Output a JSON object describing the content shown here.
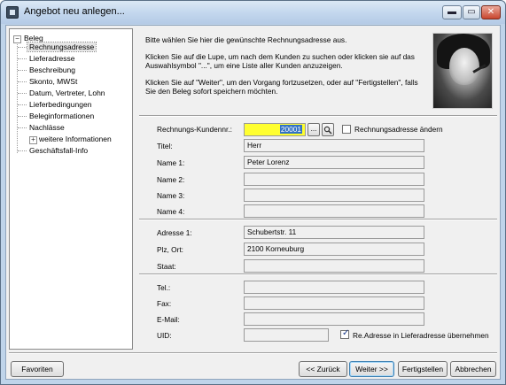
{
  "window": {
    "title": "Angebot neu anlegen..."
  },
  "titlebar_buttons": {
    "minimize": "▬",
    "maximize": "▭",
    "close": "✕"
  },
  "tree": {
    "root": {
      "label": "Beleg",
      "toggle": "−"
    },
    "items": [
      {
        "label": "Rechnungsadresse",
        "selected": true
      },
      {
        "label": "Lieferadresse"
      },
      {
        "label": "Beschreibung"
      },
      {
        "label": "Skonto, MWSt"
      },
      {
        "label": "Datum, Vertreter, Lohn"
      },
      {
        "label": "Lieferbedingungen"
      },
      {
        "label": "Beleginformationen"
      },
      {
        "label": "Nachlässe"
      },
      {
        "label": "weitere Informationen",
        "toggle": "+"
      },
      {
        "label": "Geschäftsfall-Info"
      }
    ]
  },
  "info": {
    "p1": "Bitte wählen Sie hier die gewünschte Rechnungsadresse aus.",
    "p2": "Klicken Sie auf die Lupe, um nach dem Kunden zu suchen oder klicken sie auf das Auswahlsymbol \"...\", um eine Liste aller Kunden anzuzeigen.",
    "p3": "Klicken Sie auf \"Weiter\", um den Vorgang fortzusetzen, oder auf \"Fertigstellen\", falls Sie den Beleg sofort speichern möchten."
  },
  "form": {
    "kundennr_label": "Rechnungs-Kundennr.:",
    "kundennr_value": "20001",
    "browse_button": "...",
    "search_icon": "magnifier-icon",
    "change_address_label": "Rechnungsadresse ändern",
    "change_address_checked": false,
    "titel_label": "Titel:",
    "titel_value": "Herr",
    "name1_label": "Name 1:",
    "name1_value": "Peter Lorenz",
    "name2_label": "Name 2:",
    "name2_value": "",
    "name3_label": "Name 3:",
    "name3_value": "",
    "name4_label": "Name 4:",
    "name4_value": "",
    "adresse1_label": "Adresse 1:",
    "adresse1_value": "Schubertstr. 11",
    "plz_label": "Plz, Ort:",
    "plz_value": "2100  Korneuburg",
    "staat_label": "Staat:",
    "staat_value": "",
    "tel_label": "Tel.:",
    "tel_value": "",
    "fax_label": "Fax:",
    "fax_value": "",
    "email_label": "E-Mail:",
    "email_value": "",
    "uid_label": "UID:",
    "uid_value": "",
    "copy_delivery_label": "Re.Adresse in Lieferadresse übernehmen",
    "copy_delivery_checked": true
  },
  "buttons": {
    "favoriten": "Favoriten",
    "zurueck": "<< Zurück",
    "weiter": "Weiter >>",
    "fertigstellen": "Fertigstellen",
    "abbrechen": "Abbrechen"
  }
}
